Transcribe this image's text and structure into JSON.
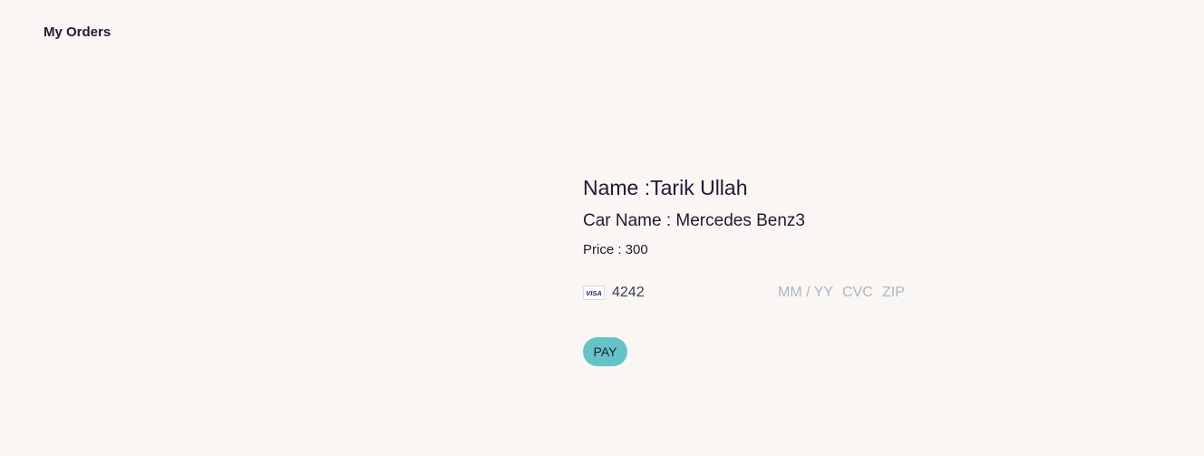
{
  "nav": {
    "my_orders_label": "My Orders"
  },
  "order": {
    "name_text": "Name :Tarik Ullah",
    "car_text": "Car Name : Mercedes Benz3",
    "price_text": "Price : 300"
  },
  "payment": {
    "card_brand": "visa",
    "card_brand_label": "VISA",
    "card_number_value": "4242",
    "expiry_placeholder": "MM / YY",
    "cvc_placeholder": "CVC",
    "zip_placeholder": "ZIP",
    "pay_label": "PAY"
  },
  "colors": {
    "background": "#faf6f3",
    "text": "#1f1b33",
    "pay_button": "#65c3c8",
    "placeholder": "#aab7c4",
    "visa_blue": "#1a1f71"
  }
}
